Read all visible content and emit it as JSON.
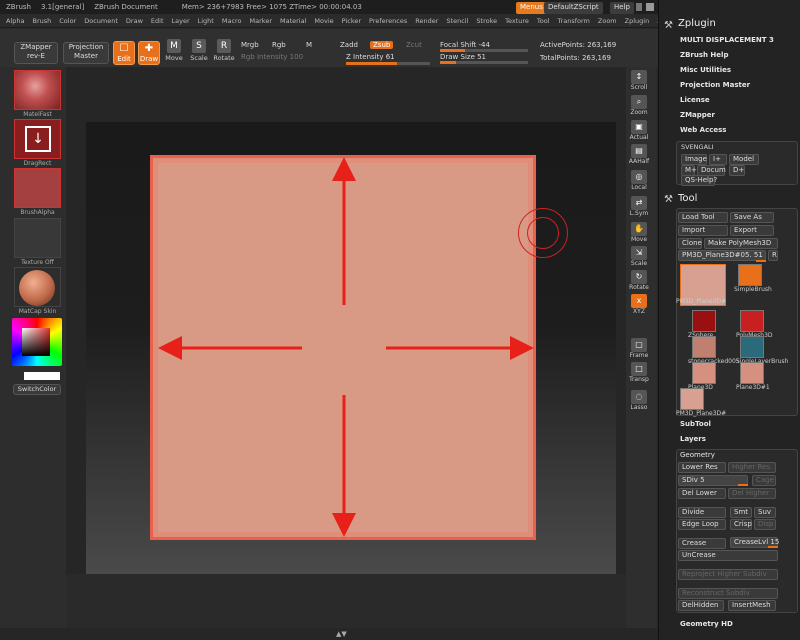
{
  "titlebar": {
    "app": "ZBrush",
    "version": "3.1[general]",
    "doc": "ZBrush Document",
    "mem": "Mem> 236+7983 Free> 1075 ZTime> 00:00:04.03",
    "menus_btn": "Menus",
    "script_btn": "DefaultZScript",
    "help_btn": "Help"
  },
  "menubar": [
    "Alpha",
    "Brush",
    "Color",
    "Document",
    "Draw",
    "Edit",
    "Layer",
    "Light",
    "Macro",
    "Marker",
    "Material",
    "Movie",
    "Picker",
    "Preferences",
    "Render",
    "Stencil",
    "Stroke",
    "Texture",
    "Tool",
    "Transform",
    "Zoom",
    "Zplugin",
    "Zscript"
  ],
  "toolbar": {
    "zmapper": "ZMapper",
    "zmapper2": "rev-E",
    "projection": "Projection",
    "projection2": "Master",
    "edit": "Edit",
    "draw": "Draw",
    "move": "Move",
    "scale": "Scale",
    "rotate": "Rotate",
    "mrgb": "Mrgb",
    "rgb": "Rgb",
    "m": "M",
    "rgb_intensity": "Rgb Intensity 100",
    "zadd": "Zadd",
    "zsub": "Zsub",
    "zcut": "Zcut",
    "z_intensity": "Z Intensity 61",
    "focal_shift": "Focal Shift -44",
    "draw_size": "Draw Size 51",
    "active_points": "ActivePoints: 263,169",
    "total_points": "TotalPoints: 263,169",
    "focal_fill": 0.28,
    "drawsize_fill": 0.18,
    "zint_fill": 0.61
  },
  "left": {
    "material": "MatelFast",
    "stroke": "DragRect",
    "alpha": "BrushAlpha",
    "texture": "Texture Off",
    "matcap": "MatCap Skin",
    "switch_color": "SwitchColor"
  },
  "righticons": [
    "Scroll",
    "Zoom",
    "Actual",
    "AAHalf",
    "Local",
    "L.Sym",
    "Move",
    "Scale",
    "Rotate",
    "XYZ",
    "Frame",
    "Transp",
    "Lasso"
  ],
  "zplugin": {
    "title": "Zplugin",
    "items": [
      "MULTI DISPLACEMENT 3",
      "ZBrush Help",
      "Misc Utilities",
      "Projection Master",
      "License",
      "ZMapper",
      "Web Access"
    ],
    "svengali": "SVENGALI",
    "sv_buttons": [
      "Image",
      "I+",
      "Model",
      "M+",
      "Docum",
      "D+",
      "QS-Help?"
    ]
  },
  "tool": {
    "title": "Tool",
    "load": "Load Tool",
    "save": "Save As",
    "import": "Import",
    "export": "Export",
    "clone": "Clone",
    "make_poly": "Make PolyMesh3D",
    "current": "PM3D_Plane3D#05. 51",
    "r": "R",
    "thumbs": [
      "PM3D_Plane3D#",
      "SimpleBrush",
      "ZSphere",
      "PolyMesh3D",
      "stonecracked005",
      "SingleLayerBrush",
      "Plane3D",
      "Plane3D#1",
      "PM3D_Plane3D#"
    ],
    "subtool": "SubTool",
    "layers": "Layers",
    "geometry": "Geometry",
    "lower_res": "Lower Res",
    "higher_res": "Higher Res",
    "sdiv": "SDiv 5",
    "cage": "Cage",
    "del_lower": "Del Lower",
    "del_higher": "Del Higher",
    "divide": "Divide",
    "smt": "Smt",
    "suv": "Suv",
    "edge_loop": "Edge Loop",
    "crisp": "Crisp",
    "disp": "Disp",
    "crease": "Crease",
    "crease_lvl": "CreaseLvl 15",
    "uncrease": "UnCrease",
    "reproject": "Reproject Higher Subdiv",
    "reconstruct": "Reconstruct Subdiv",
    "del_hidden": "DelHidden",
    "insert_mesh": "InsertMesh",
    "geometry_hd": "Geometry HD"
  },
  "colors": {
    "accent": "#e8701a",
    "arrow": "#e8201a",
    "canvas": "#d99a85"
  }
}
